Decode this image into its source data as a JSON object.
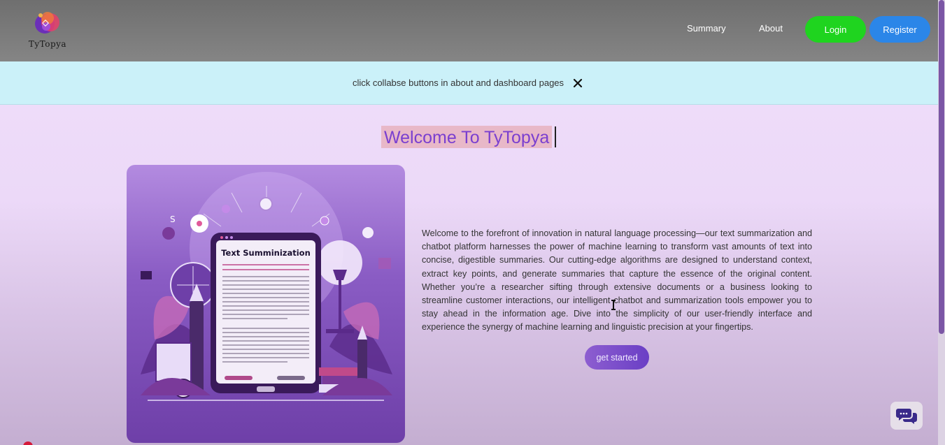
{
  "header": {
    "logo_text": "TyTopya",
    "nav": {
      "summary": "Summary",
      "about": "About"
    },
    "login_label": "Login",
    "register_label": "Register",
    "colors": {
      "login": "#1fd41f",
      "register": "#2b86e8"
    }
  },
  "notice": {
    "text": "click collabse buttons in about and dashboard pages",
    "close_icon": "close-icon"
  },
  "main": {
    "title": "Welcome To TyTopya",
    "image": {
      "heading": "Text Summinization",
      "icon": "text-summarization-illustration"
    },
    "description": "Welcome to the forefront of innovation in natural language processing—our text summarization and chatbot platform harnesses the power of machine learning to transform vast amounts of text into concise, digestible summaries. Our cutting-edge algorithms are designed to understand context, extract key points, and generate summaries that capture the essence of the original content. Whether you’re a researcher sifting through extensive documents or a business looking to streamline customer interactions, our intelligent chatbot and summarization tools empower you to stay ahead in the information age. Dive into the simplicity of our user-friendly interface and experience the synergy of machine learning and linguistic precision at your fingertips.",
    "cta_label": "get started"
  },
  "chat": {
    "icon": "chat-bubbles-icon"
  },
  "colors": {
    "accent": "#7a3fd0",
    "title_highlight": "#e8b8c8"
  }
}
